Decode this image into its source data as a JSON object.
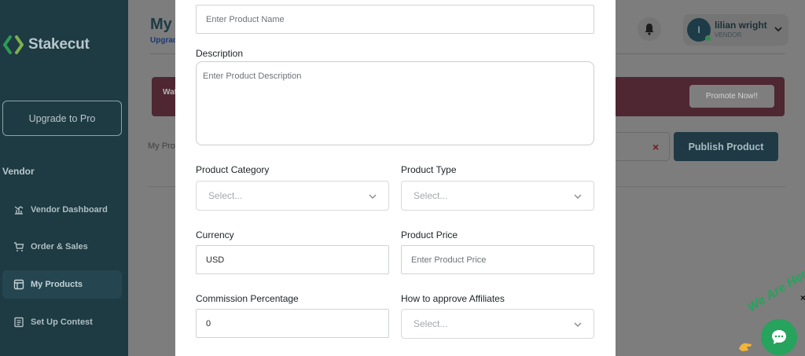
{
  "sidebar": {
    "logo_text": "Stakecut",
    "upgrade_label": "Upgrade to Pro",
    "section_title": "Vendor",
    "items": [
      {
        "label": "Vendor Dashboard",
        "icon": "dashboard-icon"
      },
      {
        "label": "Order & Sales",
        "icon": "cart-icon"
      },
      {
        "label": "My Products",
        "icon": "products-icon",
        "active": true
      },
      {
        "label": "Set Up Contest",
        "icon": "contest-icon"
      }
    ]
  },
  "header": {
    "title": "My",
    "upgrade_link": "Upgrad",
    "user": {
      "initial": "I",
      "name": "lilian wright",
      "role": "VENDOR"
    }
  },
  "banner": {
    "text": "Wat",
    "promote_label": "Promote Now!!"
  },
  "toolbar": {
    "tab_label": "My Pro",
    "clear_symbol": "×",
    "publish_label": "Publish Product"
  },
  "form": {
    "product_name": {
      "placeholder": "Enter Product Name"
    },
    "description": {
      "label": "Description",
      "placeholder": "Enter Product Description"
    },
    "category": {
      "label": "Product Category",
      "value": "Select..."
    },
    "type": {
      "label": "Product Type",
      "value": "Select..."
    },
    "currency": {
      "label": "Currency",
      "value": "USD"
    },
    "price": {
      "label": "Product Price",
      "placeholder": "Enter Product Price"
    },
    "commission": {
      "label": "Commission Percentage",
      "value": "0"
    },
    "approve": {
      "label": "How to approve Affiliates",
      "value": "Select..."
    }
  },
  "chat": {
    "tagline": "We Are Here!",
    "close_symbol": "×"
  },
  "colors": {
    "sidebar": "#1e3a43",
    "accent_green": "#26a35c",
    "banner": "#4e2732"
  }
}
